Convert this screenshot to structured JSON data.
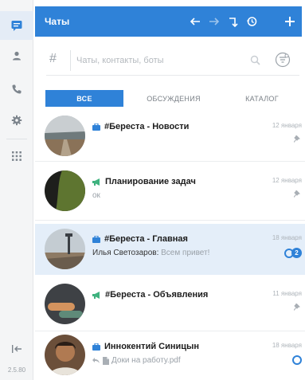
{
  "rail": {
    "version": "2.5.80",
    "items": [
      {
        "icon": "chat-bubble-icon",
        "active": true
      },
      {
        "icon": "person-icon",
        "active": false
      },
      {
        "icon": "phone-icon",
        "active": false
      },
      {
        "icon": "gear-icon",
        "active": false
      },
      {
        "icon": "apps-grid-icon",
        "active": false
      }
    ],
    "collapse_icon": "collapse-left-icon"
  },
  "header": {
    "title": "Чаты",
    "buttons": [
      "arrow-left-icon",
      "arrow-right-icon",
      "redo-icon",
      "history-icon",
      "plus-icon"
    ],
    "color": "#2f82d8"
  },
  "search": {
    "placeholder": "Чаты, контакты, боты",
    "value": ""
  },
  "tabs": [
    {
      "label": "ВСЕ",
      "active": true
    },
    {
      "label": "ОБСУЖДЕНИЯ",
      "active": false
    },
    {
      "label": "КАТАЛОГ",
      "active": false
    }
  ],
  "chats": [
    {
      "type": "channel",
      "name": "#Береста - Новости",
      "date": "12 января",
      "subtitle": "",
      "pinned": true
    },
    {
      "type": "broadcast",
      "name": "Планирование задач",
      "date": "12 января",
      "subtitle": "ок",
      "pinned": true
    },
    {
      "type": "channel",
      "name": "#Береста - Главная",
      "date": "18 января",
      "author": "Илья Светозаров:",
      "subtitle": "Всем привет!",
      "unread": "2",
      "selected": true
    },
    {
      "type": "broadcast",
      "name": "#Береста - Объявления",
      "date": "11 января",
      "subtitle": "",
      "pinned": true
    },
    {
      "type": "direct",
      "name": "Иннокентий Синицын",
      "date": "18 января",
      "subtitle": "Доки на работу.pdf",
      "attachment_icon": "file-icon",
      "status_icon": "delivered-icon"
    }
  ],
  "colors": {
    "accent": "#2f82d8",
    "selected_bg": "#e4eef9",
    "broadcast_green": "#3fb27f"
  }
}
